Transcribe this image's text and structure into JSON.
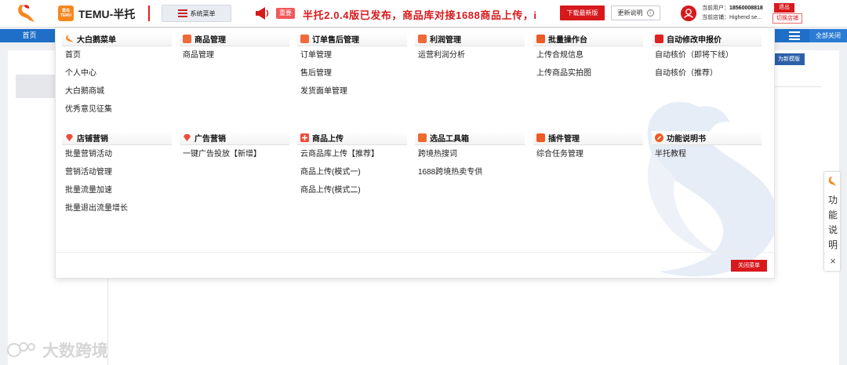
{
  "header": {
    "brand_badge": "菜鸟 TEMU",
    "brand_name": "TEMU-半托",
    "system_menu_label": "系统菜单",
    "important_tag": "重要",
    "announcement": "半托2.0.4版已发布，商品库对接1688商品上传，i",
    "download_label": "下载最新版",
    "changelog_label": "更新说明",
    "current_user_label": "当前用户：",
    "current_user_value": "18560008818",
    "current_shop_label": "当前店铺：",
    "current_shop_value": "Highend se...",
    "logout_label": "退出",
    "switch_shop_label": "切换店铺"
  },
  "tabbar": {
    "home_label": "首页",
    "close_all_label": "全部关闭"
  },
  "content": {
    "new_template_label": "为新模版"
  },
  "mega_menu": {
    "sections": [
      {
        "title": "大白鹅菜单",
        "icon": "swan-icon",
        "items": [
          "首页",
          "个人中心",
          "大白鹅商城",
          "优秀意见征集"
        ]
      },
      {
        "title": "商品管理",
        "icon": "goods-icon",
        "items": [
          "商品管理"
        ]
      },
      {
        "title": "订单售后管理",
        "icon": "order-icon",
        "items": [
          "订单管理",
          "售后管理",
          "发货面单管理"
        ]
      },
      {
        "title": "利润管理",
        "icon": "profit-icon",
        "items": [
          "运营利润分析"
        ]
      },
      {
        "title": "批量操作台",
        "icon": "batch-icon",
        "items": [
          "上传合规信息",
          "上传商品实拍图"
        ]
      },
      {
        "title": "自动修改申报价",
        "icon": "price-icon",
        "items": [
          "自动核价（即将下线）",
          "自动核价（推荐）"
        ]
      },
      {
        "title": "店铺营销",
        "icon": "diamond-icon",
        "items": [
          "批量营销活动",
          "营销活动管理",
          "批量流量加速",
          "批量退出流量增长"
        ]
      },
      {
        "title": "广告营销",
        "icon": "ad-icon",
        "items": [
          "一键广告投放【新增】"
        ]
      },
      {
        "title": "商品上传",
        "icon": "upload-icon",
        "items": [
          "云商品库上传【推荐】",
          "商品上传(模式一)",
          "商品上传(模式二)"
        ]
      },
      {
        "title": "选品工具箱",
        "icon": "toolbox-icon",
        "items": [
          "跨境热搜词",
          "1688跨境热卖专供"
        ]
      },
      {
        "title": "插件管理",
        "icon": "plugin-icon",
        "items": [
          "综合任务管理"
        ]
      },
      {
        "title": "功能说明书",
        "icon": "manual-icon",
        "items": [
          "半托教程"
        ]
      }
    ],
    "close_label": "关闭菜单"
  },
  "help_float": {
    "chars": [
      "功",
      "能",
      "说",
      "明"
    ],
    "close_glyph": "×"
  },
  "watermark": "大数跨境",
  "colors": {
    "brand_red": "#d7191c",
    "tab_blue": "#1f6fc8",
    "orange": "#f7871e"
  }
}
